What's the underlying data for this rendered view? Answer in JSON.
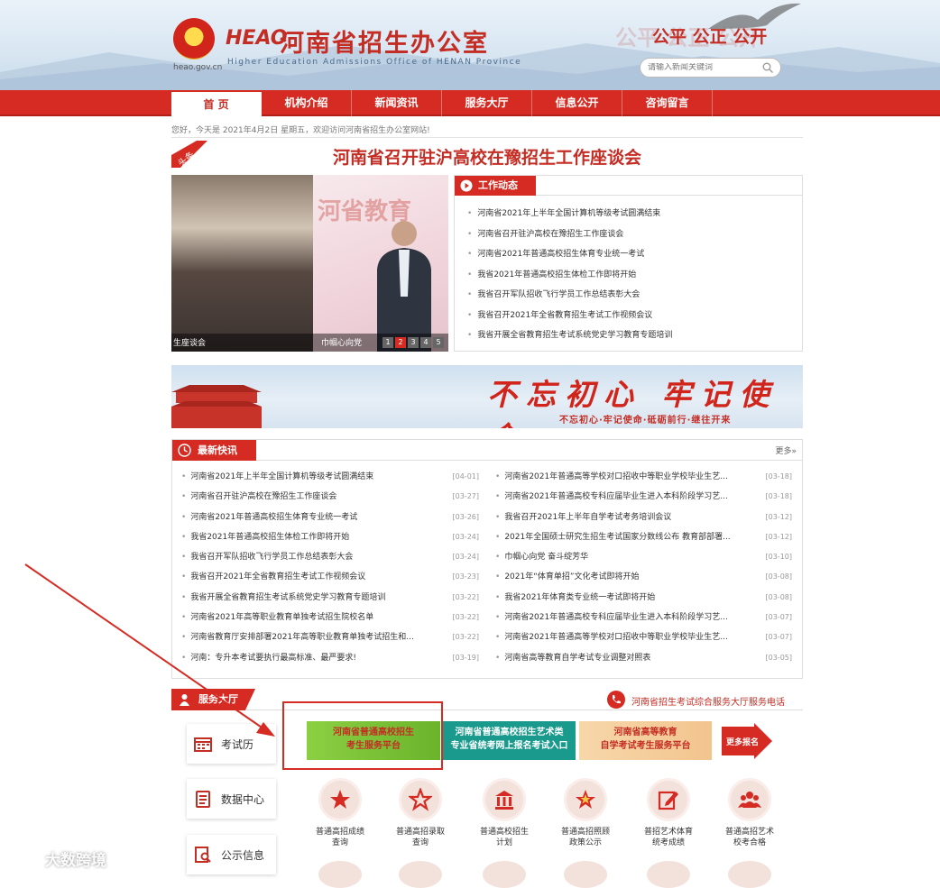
{
  "header": {
    "domain": "heao.gov.cn",
    "logo_abbr": "HEAO",
    "title": "河南省招生办公室",
    "subtitle": "Higher Education Admissions Office of HENAN Province",
    "slogan": "公平 公正 公开",
    "search_placeholder": "请输入新闻关键词"
  },
  "nav": {
    "items": [
      "首 页",
      "机构介绍",
      "新闻资讯",
      "服务大厅",
      "信息公开",
      "咨询留言"
    ],
    "active": 0
  },
  "greeting": "您好，今天是 2021年4月2日 星期五，欢迎访问河南省招生办公室网站!",
  "headline": {
    "tag": "头条",
    "title": "河南省召开驻沪高校在豫招生工作座谈会"
  },
  "slider": {
    "photo_text": "河省教育",
    "caption_left": "生座谈会",
    "caption_right": "巾帼心向党",
    "pages": [
      "1",
      "2",
      "3",
      "4",
      "5"
    ],
    "active_page": 1
  },
  "work": {
    "tab": "工作动态",
    "items": [
      "河南省2021年上半年全国计算机等级考试圆满结束",
      "河南省召开驻沪高校在豫招生工作座谈会",
      "河南省2021年普通高校招生体育专业统一考试",
      "我省2021年普通高校招生体检工作即将开始",
      "我省召开军队招收飞行学员工作总结表彰大会",
      "我省召开2021年全省教育招生考试工作视频会议",
      "我省开展全省教育招生考试系统党史学习教育专题培训"
    ]
  },
  "banner": {
    "main": "不忘初心 牢记使命",
    "sub": "不忘初心·牢记使命·砥砺前行·继往开来"
  },
  "news": {
    "tab": "最新快讯",
    "more": "更多»",
    "left": [
      {
        "title": "河南省2021年上半年全国计算机等级考试圆满结束",
        "date": "[04-01]"
      },
      {
        "title": "河南省召开驻沪高校在豫招生工作座谈会",
        "date": "[03-27]"
      },
      {
        "title": "河南省2021年普通高校招生体育专业统一考试",
        "date": "[03-26]"
      },
      {
        "title": "我省2021年普通高校招生体检工作即将开始",
        "date": "[03-24]"
      },
      {
        "title": "我省召开军队招收飞行学员工作总结表彰大会",
        "date": "[03-24]"
      },
      {
        "title": "我省召开2021年全省教育招生考试工作视频会议",
        "date": "[03-23]"
      },
      {
        "title": "我省开展全省教育招生考试系统党史学习教育专题培训",
        "date": "[03-22]"
      },
      {
        "title": "河南省2021年高等职业教育单独考试招生院校名单",
        "date": "[03-22]"
      },
      {
        "title": "河南省教育厅安排部署2021年高等职业教育单独考试招生和...",
        "date": "[03-22]"
      },
      {
        "title": "河南：专升本考试要执行最高标准、最严要求!",
        "date": "[03-19]"
      }
    ],
    "right": [
      {
        "title": "河南省2021年普通高等学校对口招收中等职业学校毕业生艺...",
        "date": "[03-18]"
      },
      {
        "title": "河南省2021年普通高校专科应届毕业生进入本科阶段学习艺...",
        "date": "[03-18]"
      },
      {
        "title": "我省召开2021年上半年自学考试考务培训会议",
        "date": "[03-12]"
      },
      {
        "title": "2021年全国硕士研究生招生考试国家分数线公布 教育部部署...",
        "date": "[03-12]"
      },
      {
        "title": "巾帼心向党  奋斗绽芳华",
        "date": "[03-10]"
      },
      {
        "title": "2021年“体育单招”文化考试即将开始",
        "date": "[03-08]"
      },
      {
        "title": "我省2021年体育类专业统一考试即将开始",
        "date": "[03-08]"
      },
      {
        "title": "河南省2021年普通高校专科应届毕业生进入本科阶段学习艺...",
        "date": "[03-07]"
      },
      {
        "title": "河南省2021年普通高等学校对口招收中等职业学校毕业生艺...",
        "date": "[03-07]"
      },
      {
        "title": "河南省高等教育自学考试专业调整对照表",
        "date": "[03-05]"
      }
    ]
  },
  "service": {
    "tab": "服务大厅",
    "phone_text": "河南省招生考试综合服务大厅服务电话",
    "side": [
      "考试历",
      "数据中心",
      "公示信息"
    ],
    "platforms": [
      {
        "line1": "河南省普通高校招生",
        "line2": "考生服务平台"
      },
      {
        "line1": "河南省普通高校招生艺术类",
        "line2": "专业省统考网上报名考试入口"
      },
      {
        "line1": "河南省高等教育",
        "line2": "自学考试考生服务平台"
      }
    ],
    "more_label": "更多报名",
    "quick": [
      {
        "l1": "普通高招成绩",
        "l2": "查询"
      },
      {
        "l1": "普通高招录取",
        "l2": "查询"
      },
      {
        "l1": "普通高校招生",
        "l2": "计划"
      },
      {
        "l1": "普通高招照顾",
        "l2": "政策公示"
      },
      {
        "l1": "普招艺术体育",
        "l2": "统考成绩"
      },
      {
        "l1": "普通高招艺术",
        "l2": "校考合格"
      }
    ]
  },
  "watermark": "大数跨境",
  "colors": {
    "brand_red": "#d52b22",
    "teal": "#1a9a8c",
    "green": "#7cc23a"
  }
}
